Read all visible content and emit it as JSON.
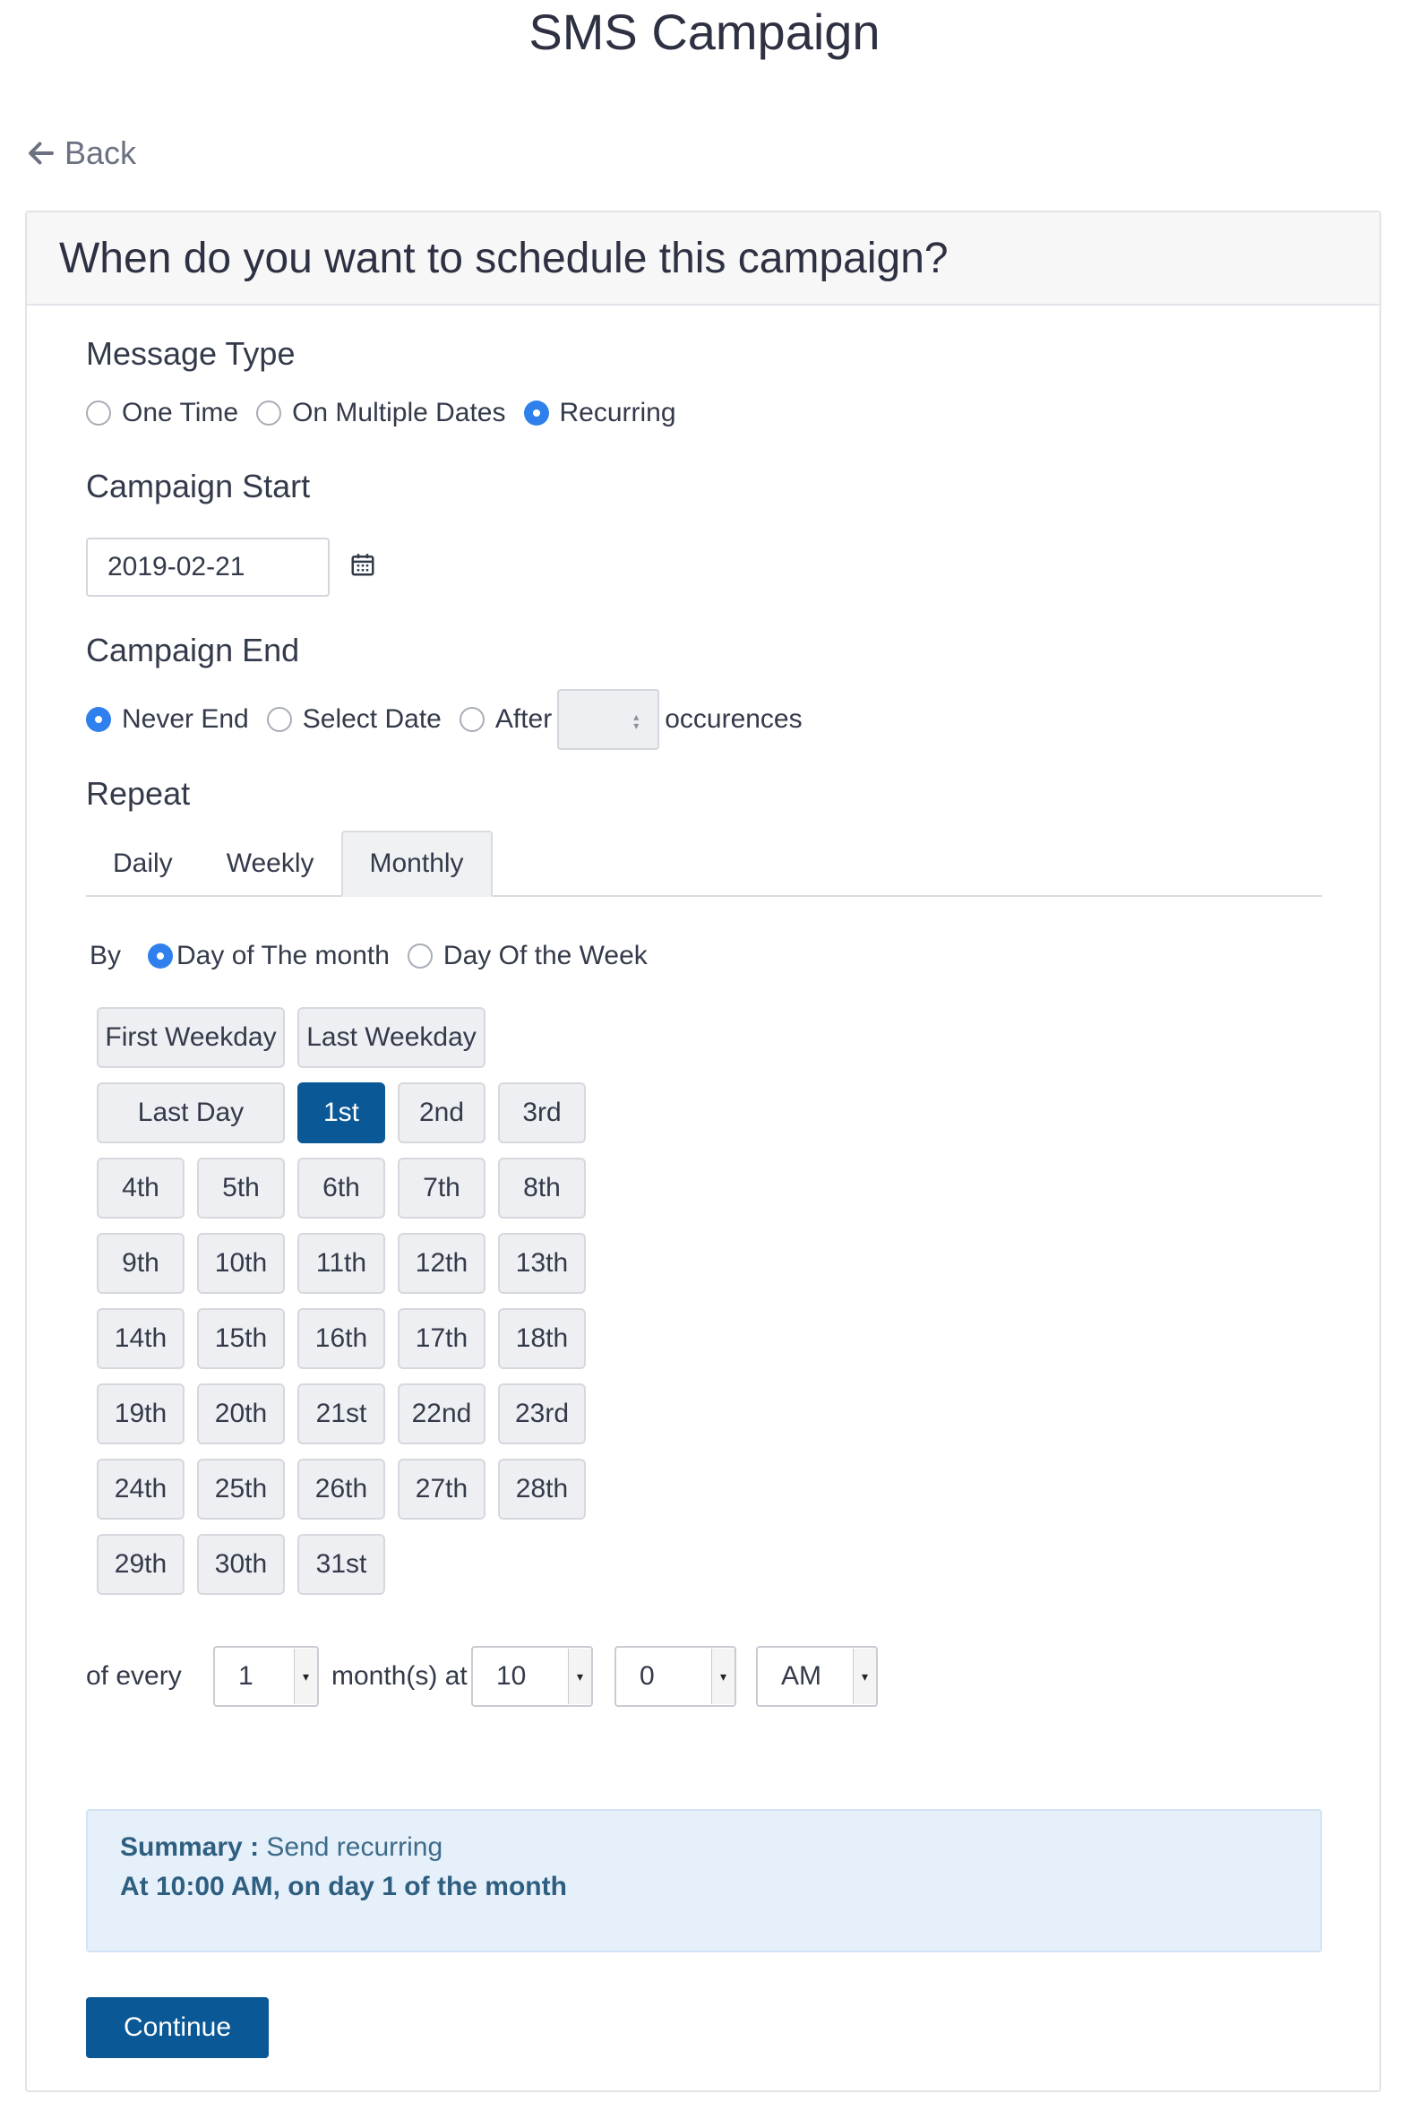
{
  "page": {
    "title": "SMS Campaign",
    "back_label": "Back"
  },
  "card": {
    "header": "When do you want to schedule this campaign?"
  },
  "message_type": {
    "label": "Message Type",
    "options": [
      {
        "label": "One Time",
        "checked": false
      },
      {
        "label": "On Multiple Dates",
        "checked": false
      },
      {
        "label": "Recurring",
        "checked": true
      }
    ]
  },
  "campaign_start": {
    "label": "Campaign Start",
    "value": "2019-02-21"
  },
  "campaign_end": {
    "label": "Campaign End",
    "options": [
      {
        "label": "Never End",
        "checked": true
      },
      {
        "label": "Select Date",
        "checked": false
      },
      {
        "label": "After",
        "checked": false
      }
    ],
    "occurrences_value": "",
    "occurrences_label": "occurences"
  },
  "repeat": {
    "label": "Repeat",
    "tabs": [
      {
        "label": "Daily",
        "active": false
      },
      {
        "label": "Weekly",
        "active": false
      },
      {
        "label": "Monthly",
        "active": true
      }
    ],
    "by_label": "By",
    "by_options": [
      {
        "label": "Day of The month",
        "checked": true
      },
      {
        "label": "Day Of the Week",
        "checked": false
      }
    ],
    "special_days": [
      "First Weekday",
      "Last Weekday",
      "Last Day"
    ],
    "days": [
      "1st",
      "2nd",
      "3rd",
      "4th",
      "5th",
      "6th",
      "7th",
      "8th",
      "9th",
      "10th",
      "11th",
      "12th",
      "13th",
      "14th",
      "15th",
      "16th",
      "17th",
      "18th",
      "19th",
      "20th",
      "21st",
      "22nd",
      "23rd",
      "24th",
      "25th",
      "26th",
      "27th",
      "28th",
      "29th",
      "30th",
      "31st"
    ],
    "selected_day": "1st"
  },
  "schedule": {
    "of_every_label": "of every",
    "interval_value": "1",
    "months_at_label": "month(s) at",
    "hour_value": "10",
    "minute_value": "0",
    "ampm_value": "AM"
  },
  "summary": {
    "key": "Summary :",
    "text": "Send recurring",
    "line2": "At 10:00 AM, on day 1 of the month"
  },
  "continue_label": "Continue"
}
